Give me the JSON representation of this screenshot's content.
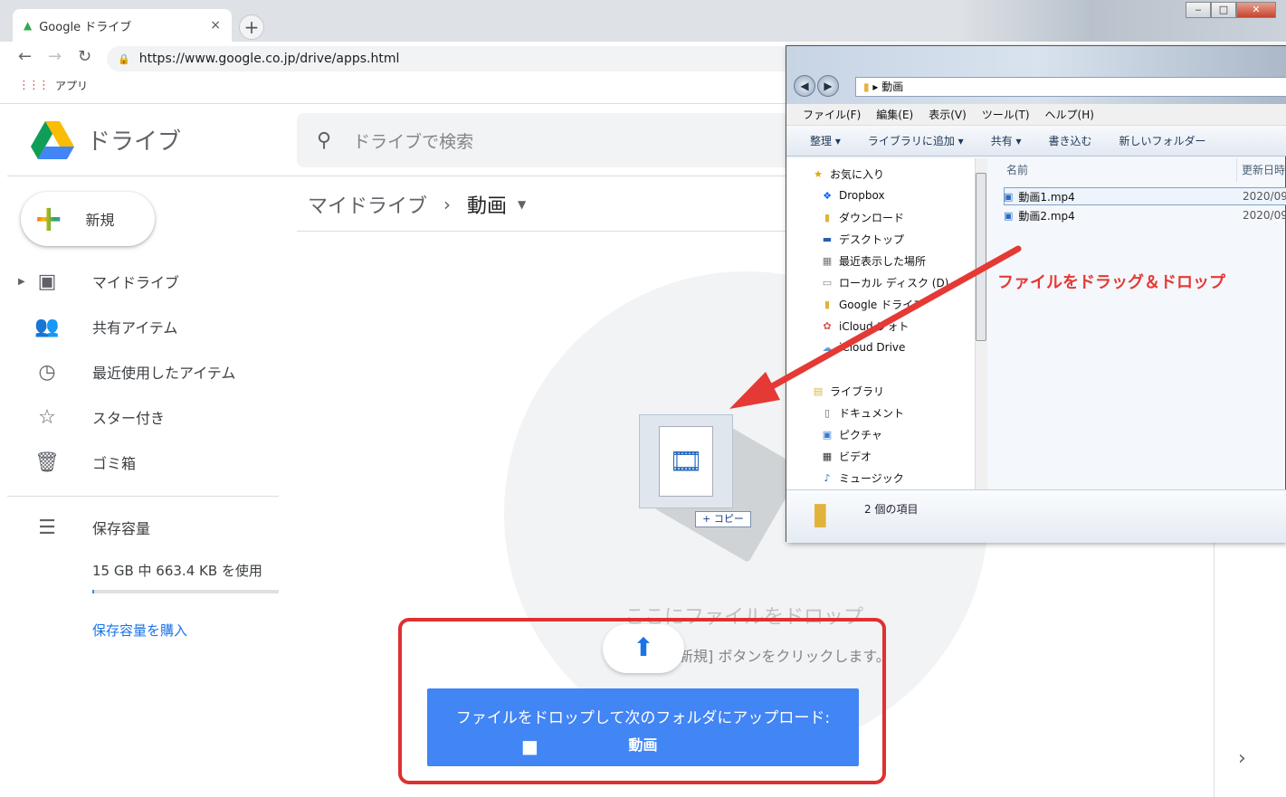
{
  "browser": {
    "tab_title": "Google ドライブ",
    "tab_close": "×",
    "new_tab": "+",
    "url": "https://www.google.co.jp/drive/apps.html",
    "bookmark": "アプリ",
    "window_buttons": [
      "‒",
      "□",
      "✕"
    ]
  },
  "drive": {
    "logo_text": "ドライブ",
    "search_placeholder": "ドライブで検索",
    "new_label": "新規",
    "nav": [
      "マイドライブ",
      "共有アイテム",
      "最近使用したアイテム",
      "スター付き",
      "ゴミ箱"
    ],
    "storage_label": "保存容量",
    "storage_text": "15 GB 中 663.4 KB を使用",
    "storage_used_fraction": 4e-05,
    "buy_storage": "保存容量を購入",
    "breadcrumb": {
      "root": "マイドライブ",
      "sep": "›",
      "current": "動画"
    },
    "drop_message": "ここにファイルをドロップ",
    "drop_sub": "新規] ボタンをクリックします。",
    "upload_banner": "ファイルをドロップして次のフォルダにアップロード:",
    "upload_folder": "動画",
    "copy_badge": "+ コピー",
    "accent": "#4285f4"
  },
  "explorer": {
    "address": "動画",
    "menu": [
      "ファイル(F)",
      "編集(E)",
      "表示(V)",
      "ツール(T)",
      "ヘルプ(H)"
    ],
    "commands": [
      "整理 ▾",
      "ライブラリに追加 ▾",
      "共有 ▾",
      "書き込む",
      "新しいフォルダー"
    ],
    "tree": [
      "お気に入り",
      "Dropbox",
      "ダウンロード",
      "デスクトップ",
      "最近表示した場所",
      "ローカル ディスク (D)",
      "Google ドライブ",
      "iCloud フォト",
      "iCloud Drive",
      "ライブラリ",
      "ドキュメント",
      "ピクチャ",
      "ビデオ",
      "ミュージック"
    ],
    "col_name": "名前",
    "col_date": "更新日時",
    "files": [
      {
        "name": "動画1.mp4",
        "date": "2020/09"
      },
      {
        "name": "動画2.mp4",
        "date": "2020/09"
      }
    ],
    "status": "2 個の項目"
  },
  "annotation": {
    "label": "ファイルをドラッグ＆ドロップ",
    "color": "#e53935"
  }
}
